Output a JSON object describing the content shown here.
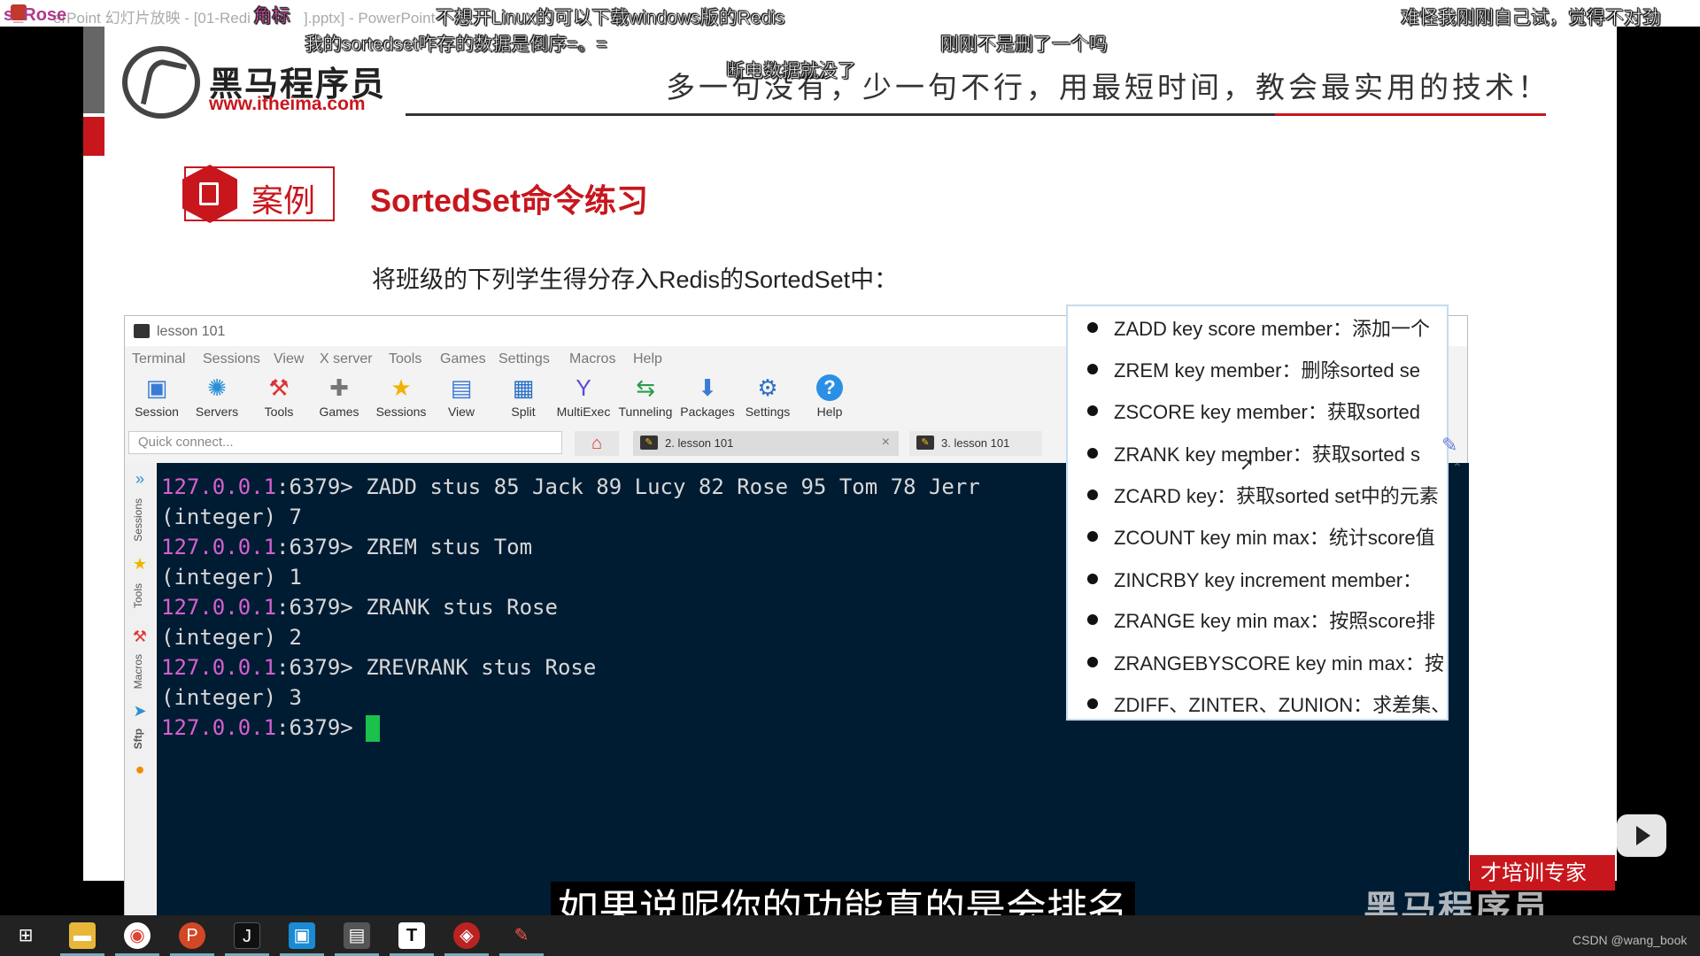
{
  "ppt_window": {
    "title_fragment": "erPoint 幻灯片放映 - [01-Redi",
    "title_fragment_2": "].pptx] - PowerPoint"
  },
  "username": "s_Rose",
  "slide": {
    "brand_cn": "黑马程序员",
    "brand_url": "www.itheima.com",
    "slogan": "多一句没有，少一句不行，用最短时间，教会最实用的技术！",
    "case_label": "案例",
    "title": "SortedSet命令练习",
    "subtitle": "将班级的下列学生得分存入Redis的SortedSet中："
  },
  "moba": {
    "title": "lesson 101",
    "menu": [
      "Terminal",
      "Sessions",
      "View",
      "X server",
      "Tools",
      "Games",
      "Settings",
      "Macros",
      "Help"
    ],
    "toolbar": [
      {
        "label": "Session",
        "icon": "session-icon"
      },
      {
        "label": "Servers",
        "icon": "servers-icon"
      },
      {
        "label": "Tools",
        "icon": "tools-icon"
      },
      {
        "label": "Games",
        "icon": "games-icon"
      },
      {
        "label": "Sessions",
        "icon": "star-icon"
      },
      {
        "label": "View",
        "icon": "view-icon"
      },
      {
        "label": "Split",
        "icon": "split-icon"
      },
      {
        "label": "MultiExec",
        "icon": "multiexec-icon"
      },
      {
        "label": "Tunneling",
        "icon": "tunneling-icon"
      },
      {
        "label": "Packages",
        "icon": "packages-icon"
      },
      {
        "label": "Settings",
        "icon": "gear-icon"
      },
      {
        "label": "Help",
        "icon": "help-icon"
      }
    ],
    "quick_connect_placeholder": "Quick connect...",
    "tabs": [
      {
        "label": "2. lesson 101",
        "active": true
      },
      {
        "label": "3. lesson 101",
        "active": false
      }
    ],
    "side_labels": [
      "Sessions",
      "Tools",
      "Macros",
      "Sftp"
    ]
  },
  "terminal": {
    "host": "127.0.0.1",
    "port": ":6379> ",
    "lines": [
      {
        "type": "cmd",
        "text": "ZADD stus 85 Jack 89 Lucy 82 Rose 95 Tom 78 Jerr"
      },
      {
        "type": "out",
        "text": "(integer) 7"
      },
      {
        "type": "cmd",
        "text": "ZREM stus Tom"
      },
      {
        "type": "out",
        "text": "(integer) 1"
      },
      {
        "type": "cmd",
        "text": "ZRANK stus Rose"
      },
      {
        "type": "out",
        "text": "(integer) 2"
      },
      {
        "type": "cmd",
        "text": "ZREVRANK stus Rose"
      },
      {
        "type": "out",
        "text": "(integer) 3"
      },
      {
        "type": "cmd",
        "text": ""
      }
    ]
  },
  "commands": [
    "ZADD key score member：添加一个",
    "ZREM key member：删除sorted se",
    "ZSCORE key member：获取sorted",
    "ZRANK key member：获取sorted s",
    "ZCARD key：获取sorted set中的元素",
    "ZCOUNT key min max：统计score值",
    "ZINCRBY key increment member：",
    "ZRANGE key min max：按照score排",
    "ZRANGEBYSCORE key min max：按",
    "ZDIFF、ZINTER、ZUNION：求差集、"
  ],
  "danmaku": [
    {
      "text": "角标"
    },
    {
      "text": "不想开Linux的可以下载windows版的Redis"
    },
    {
      "text": "难怪我刚刚自己试，觉得不对劲"
    },
    {
      "text": "我的sortedset咋存的数据是倒序=。="
    },
    {
      "text": "刚刚不是删了一个吗"
    },
    {
      "text": "断电数据就没了"
    }
  ],
  "subtitle": "如果说呢你的功能真的是会排名",
  "watermark": {
    "banner": "才培训专家",
    "brand": "黑马程序员",
    "csdn": "CSDN @wang_book"
  }
}
